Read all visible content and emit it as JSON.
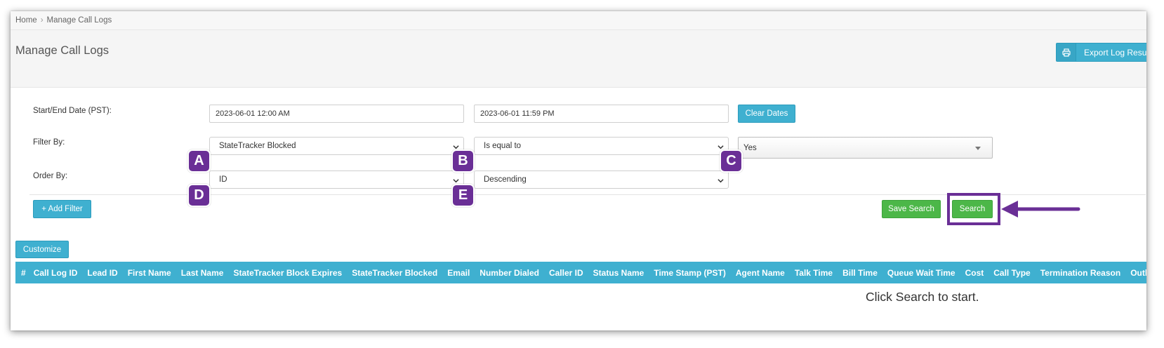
{
  "breadcrumb": {
    "home": "Home",
    "separator": "›",
    "current": "Manage Call Logs"
  },
  "page": {
    "title": "Manage Call Logs"
  },
  "export_button": {
    "label": "Export Log Results",
    "icon": "printer-icon"
  },
  "filters": {
    "date_row": {
      "label": "Start/End Date (PST):",
      "start": "2023-06-01 12:00 AM",
      "end": "2023-06-01 11:59 PM",
      "clear_label": "Clear Dates"
    },
    "filter_row": {
      "label": "Filter By:",
      "field": "StateTracker Blocked",
      "operator": "Is equal to",
      "value": "Yes"
    },
    "order_row": {
      "label": "Order By:",
      "field": "ID",
      "direction": "Descending"
    },
    "add_filter_label": "+ Add Filter",
    "save_search_label": "Save Search",
    "search_label": "Search"
  },
  "annotations": {
    "a": "A",
    "b": "B",
    "c": "C",
    "d": "D",
    "e": "E"
  },
  "customize_label": "Customize",
  "table": {
    "columns": [
      "#",
      "Call Log ID",
      "Lead ID",
      "First Name",
      "Last Name",
      "StateTracker Block Expires",
      "StateTracker Blocked",
      "Email",
      "Number Dialed",
      "Caller ID",
      "Status Name",
      "Time Stamp (PST)",
      "Agent Name",
      "Talk Time",
      "Bill Time",
      "Queue Wait Time",
      "Cost",
      "Call Type",
      "Termination Reason",
      "Outbound"
    ],
    "empty_message": "Click Search to start."
  },
  "colors": {
    "info": "#3fb0d0",
    "success": "#4cb748",
    "annotation": "#6a2f96"
  }
}
